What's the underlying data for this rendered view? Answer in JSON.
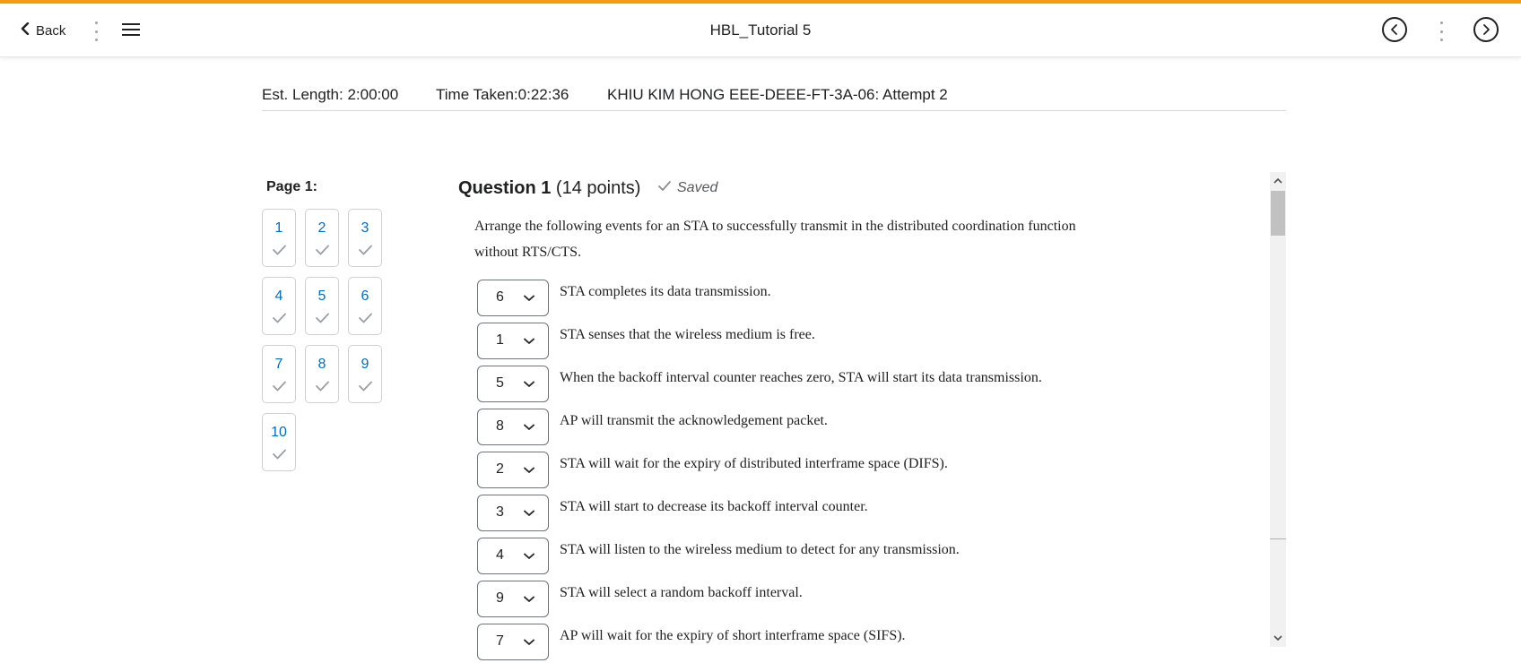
{
  "header": {
    "back_label": "Back",
    "title": "HBL_Tutorial 5",
    "accent_color": "#f39c12",
    "icons": [
      "chevron-left-icon",
      "hamburger-menu-icon",
      "previous-circle-icon",
      "next-circle-icon"
    ]
  },
  "info": {
    "est_length": "Est. Length: 2:00:00",
    "time_taken": "Time Taken:0:22:36",
    "attempt": "KHIU KIM HONG EEE-DEEE-FT-3A-06: Attempt 2"
  },
  "nav": {
    "page_label": "Page 1:",
    "questions": [
      {
        "num": "1",
        "saved": true
      },
      {
        "num": "2",
        "saved": true
      },
      {
        "num": "3",
        "saved": true
      },
      {
        "num": "4",
        "saved": true
      },
      {
        "num": "5",
        "saved": true
      },
      {
        "num": "6",
        "saved": true
      },
      {
        "num": "7",
        "saved": true
      },
      {
        "num": "8",
        "saved": true
      },
      {
        "num": "9",
        "saved": true
      },
      {
        "num": "10",
        "saved": true
      }
    ]
  },
  "question": {
    "title": "Question 1",
    "points": "(14 points)",
    "status": "Saved",
    "prompt": "Arrange the following events for an STA to successfully transmit in the distributed coordination function without RTS/CTS.",
    "items": [
      {
        "value": "6",
        "text": "STA completes its data transmission."
      },
      {
        "value": "1",
        "text": "STA senses that the wireless medium is free."
      },
      {
        "value": "5",
        "text": "When the backoff interval counter reaches zero, STA will start its data transmission."
      },
      {
        "value": "8",
        "text": "AP will transmit the acknowledgement packet."
      },
      {
        "value": "2",
        "text": "STA will wait for the expiry of distributed interframe space (DIFS)."
      },
      {
        "value": "3",
        "text": "STA will start to decrease its backoff interval counter."
      },
      {
        "value": "4",
        "text": "STA will listen to the wireless medium to detect for any transmission."
      },
      {
        "value": "9",
        "text": "STA will select a random backoff interval."
      },
      {
        "value": "7",
        "text": "AP will wait for the expiry of short interframe space (SIFS)."
      }
    ]
  },
  "colors": {
    "link": "#006fbf",
    "text": "#202122",
    "border": "#cdd1d6"
  }
}
